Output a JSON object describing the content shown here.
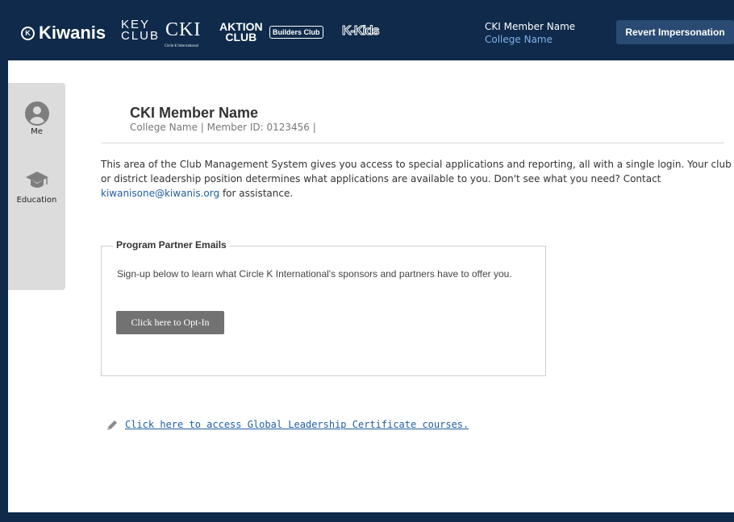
{
  "header": {
    "logos": {
      "kiwanis": "Kiwanis",
      "keyclub_top": "KEY",
      "keyclub_bottom": "CLUB",
      "cki": "CKI",
      "cki_sub": "Circle K International",
      "aktion_top": "AKTION",
      "aktion_bottom": "CLUB",
      "builders": "Builders Club",
      "kkids": "K-Kids"
    },
    "user_name": "CKI Member Name",
    "user_college": "College Name",
    "revert_label": "Revert Impersonation"
  },
  "sidebar": {
    "items": [
      {
        "label": "Me",
        "icon": "user-avatar-icon"
      },
      {
        "label": "Education",
        "icon": "graduation-cap-icon"
      }
    ]
  },
  "main": {
    "member_name": "CKI Member Name",
    "member_meta": "College Name  |  Member ID: 0123456  |",
    "intro_text": "This area of the Club Management System gives you access to special applications and reporting, all with a single login. Your club or district leadership position determines what applications are available to you. Don't see what you need? Contact ",
    "intro_email": "kiwanisone@kiwanis.org",
    "intro_suffix": " for assistance.",
    "partner": {
      "legend": "Program Partner Emails",
      "text": "Sign-up below to learn what Circle K International's sponsors and partners have to offer you.",
      "button_label": "Click here to Opt-In"
    },
    "glc_link": "Click here to access Global Leadership Certificate courses."
  },
  "colors": {
    "navy": "#0f2a4a",
    "link": "#1f5ea8",
    "college_text": "#7fb2ee",
    "button_gray": "#727272",
    "sidebar_bg": "#dcdcdc"
  }
}
